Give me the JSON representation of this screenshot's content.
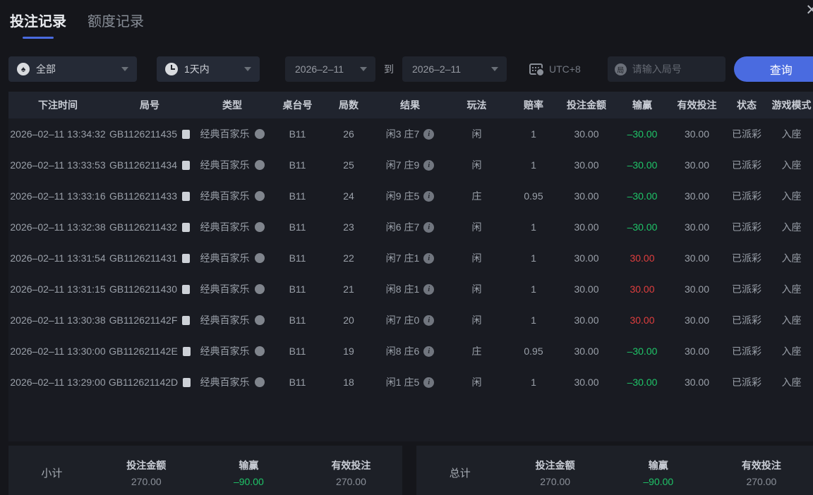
{
  "tabs": [
    {
      "label": "投注记录",
      "active": true
    },
    {
      "label": "额度记录",
      "active": false
    }
  ],
  "close_icon": "✕",
  "filters": {
    "game_type": "全部",
    "time_range": "1天内",
    "date_from": "2026–2–11",
    "to_label": "到",
    "date_to": "2026–2–11",
    "timezone": "UTC+8",
    "search_icon_glyph": "局",
    "search_placeholder": "请输入局号",
    "query_label": "查询"
  },
  "table": {
    "headers": [
      "下注时间",
      "局号",
      "类型",
      "桌台号",
      "局数",
      "结果",
      "玩法",
      "赔率",
      "投注金额",
      "输赢",
      "有效投注",
      "状态",
      "游戏模式"
    ],
    "rows": [
      {
        "time": "2026–02–11 13:34:32",
        "game_id": "GB1126211435",
        "type": "经典百家乐",
        "table_no": "B11",
        "round": "26",
        "result": "闲3 庄7",
        "play": "闲",
        "odds": "1",
        "bet": "30.00",
        "win_loss": "–30.00",
        "win_loss_color": "green",
        "valid_bet": "30.00",
        "status": "已派彩",
        "mode": "入座"
      },
      {
        "time": "2026–02–11 13:33:53",
        "game_id": "GB1126211434",
        "type": "经典百家乐",
        "table_no": "B11",
        "round": "25",
        "result": "闲7 庄9",
        "play": "闲",
        "odds": "1",
        "bet": "30.00",
        "win_loss": "–30.00",
        "win_loss_color": "green",
        "valid_bet": "30.00",
        "status": "已派彩",
        "mode": "入座"
      },
      {
        "time": "2026–02–11 13:33:16",
        "game_id": "GB1126211433",
        "type": "经典百家乐",
        "table_no": "B11",
        "round": "24",
        "result": "闲9 庄5",
        "play": "庄",
        "odds": "0.95",
        "bet": "30.00",
        "win_loss": "–30.00",
        "win_loss_color": "green",
        "valid_bet": "30.00",
        "status": "已派彩",
        "mode": "入座"
      },
      {
        "time": "2026–02–11 13:32:38",
        "game_id": "GB1126211432",
        "type": "经典百家乐",
        "table_no": "B11",
        "round": "23",
        "result": "闲6 庄7",
        "play": "闲",
        "odds": "1",
        "bet": "30.00",
        "win_loss": "–30.00",
        "win_loss_color": "green",
        "valid_bet": "30.00",
        "status": "已派彩",
        "mode": "入座"
      },
      {
        "time": "2026–02–11 13:31:54",
        "game_id": "GB1126211431",
        "type": "经典百家乐",
        "table_no": "B11",
        "round": "22",
        "result": "闲7 庄1",
        "play": "闲",
        "odds": "1",
        "bet": "30.00",
        "win_loss": "30.00",
        "win_loss_color": "red",
        "valid_bet": "30.00",
        "status": "已派彩",
        "mode": "入座"
      },
      {
        "time": "2026–02–11 13:31:15",
        "game_id": "GB1126211430",
        "type": "经典百家乐",
        "table_no": "B11",
        "round": "21",
        "result": "闲8 庄1",
        "play": "闲",
        "odds": "1",
        "bet": "30.00",
        "win_loss": "30.00",
        "win_loss_color": "red",
        "valid_bet": "30.00",
        "status": "已派彩",
        "mode": "入座"
      },
      {
        "time": "2026–02–11 13:30:38",
        "game_id": "GB112621142F",
        "type": "经典百家乐",
        "table_no": "B11",
        "round": "20",
        "result": "闲7 庄0",
        "play": "闲",
        "odds": "1",
        "bet": "30.00",
        "win_loss": "30.00",
        "win_loss_color": "red",
        "valid_bet": "30.00",
        "status": "已派彩",
        "mode": "入座"
      },
      {
        "time": "2026–02–11 13:30:00",
        "game_id": "GB112621142E",
        "type": "经典百家乐",
        "table_no": "B11",
        "round": "19",
        "result": "闲8 庄6",
        "play": "庄",
        "odds": "0.95",
        "bet": "30.00",
        "win_loss": "–30.00",
        "win_loss_color": "green",
        "valid_bet": "30.00",
        "status": "已派彩",
        "mode": "入座"
      },
      {
        "time": "2026–02–11 13:29:00",
        "game_id": "GB112621142D",
        "type": "经典百家乐",
        "table_no": "B11",
        "round": "18",
        "result": "闲1 庄5",
        "play": "闲",
        "odds": "1",
        "bet": "30.00",
        "win_loss": "–30.00",
        "win_loss_color": "green",
        "valid_bet": "30.00",
        "status": "已派彩",
        "mode": "入座"
      }
    ]
  },
  "summary": {
    "subtotal": {
      "label": "小计",
      "items": [
        {
          "label": "投注金额",
          "value": "270.00"
        },
        {
          "label": "输赢",
          "value": "–90.00",
          "color": "green"
        },
        {
          "label": "有效投注",
          "value": "270.00"
        }
      ]
    },
    "total": {
      "label": "总计",
      "items": [
        {
          "label": "投注金额",
          "value": "270.00"
        },
        {
          "label": "输赢",
          "value": "–90.00",
          "color": "green"
        },
        {
          "label": "有效投注",
          "value": "270.00"
        }
      ]
    }
  },
  "colors": {
    "accent": "#4a6be0",
    "win_red": "#e03e3e",
    "loss_green": "#1fc468"
  }
}
